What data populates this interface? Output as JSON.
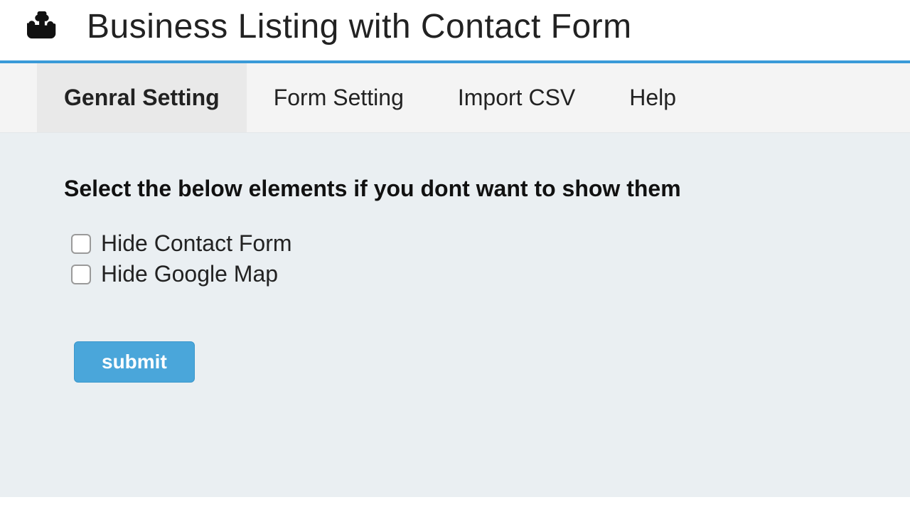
{
  "header": {
    "title": "Business Listing with Contact Form",
    "icon": "puzzle-piece"
  },
  "tabs": [
    {
      "id": "general",
      "label": "Genral Setting",
      "active": true
    },
    {
      "id": "form",
      "label": "Form Setting",
      "active": false
    },
    {
      "id": "import",
      "label": "Import CSV",
      "active": false
    },
    {
      "id": "help",
      "label": "Help",
      "active": false
    }
  ],
  "section": {
    "heading": "Select the below elements if you dont want to show them",
    "options": [
      {
        "id": "hide_contact_form",
        "label": "Hide Contact Form",
        "checked": false
      },
      {
        "id": "hide_google_map",
        "label": "Hide Google Map",
        "checked": false
      }
    ],
    "submit_label": "submit"
  },
  "colors": {
    "accent": "#3a9ad8",
    "button": "#4aa6da",
    "content_bg": "#eaeff2"
  }
}
